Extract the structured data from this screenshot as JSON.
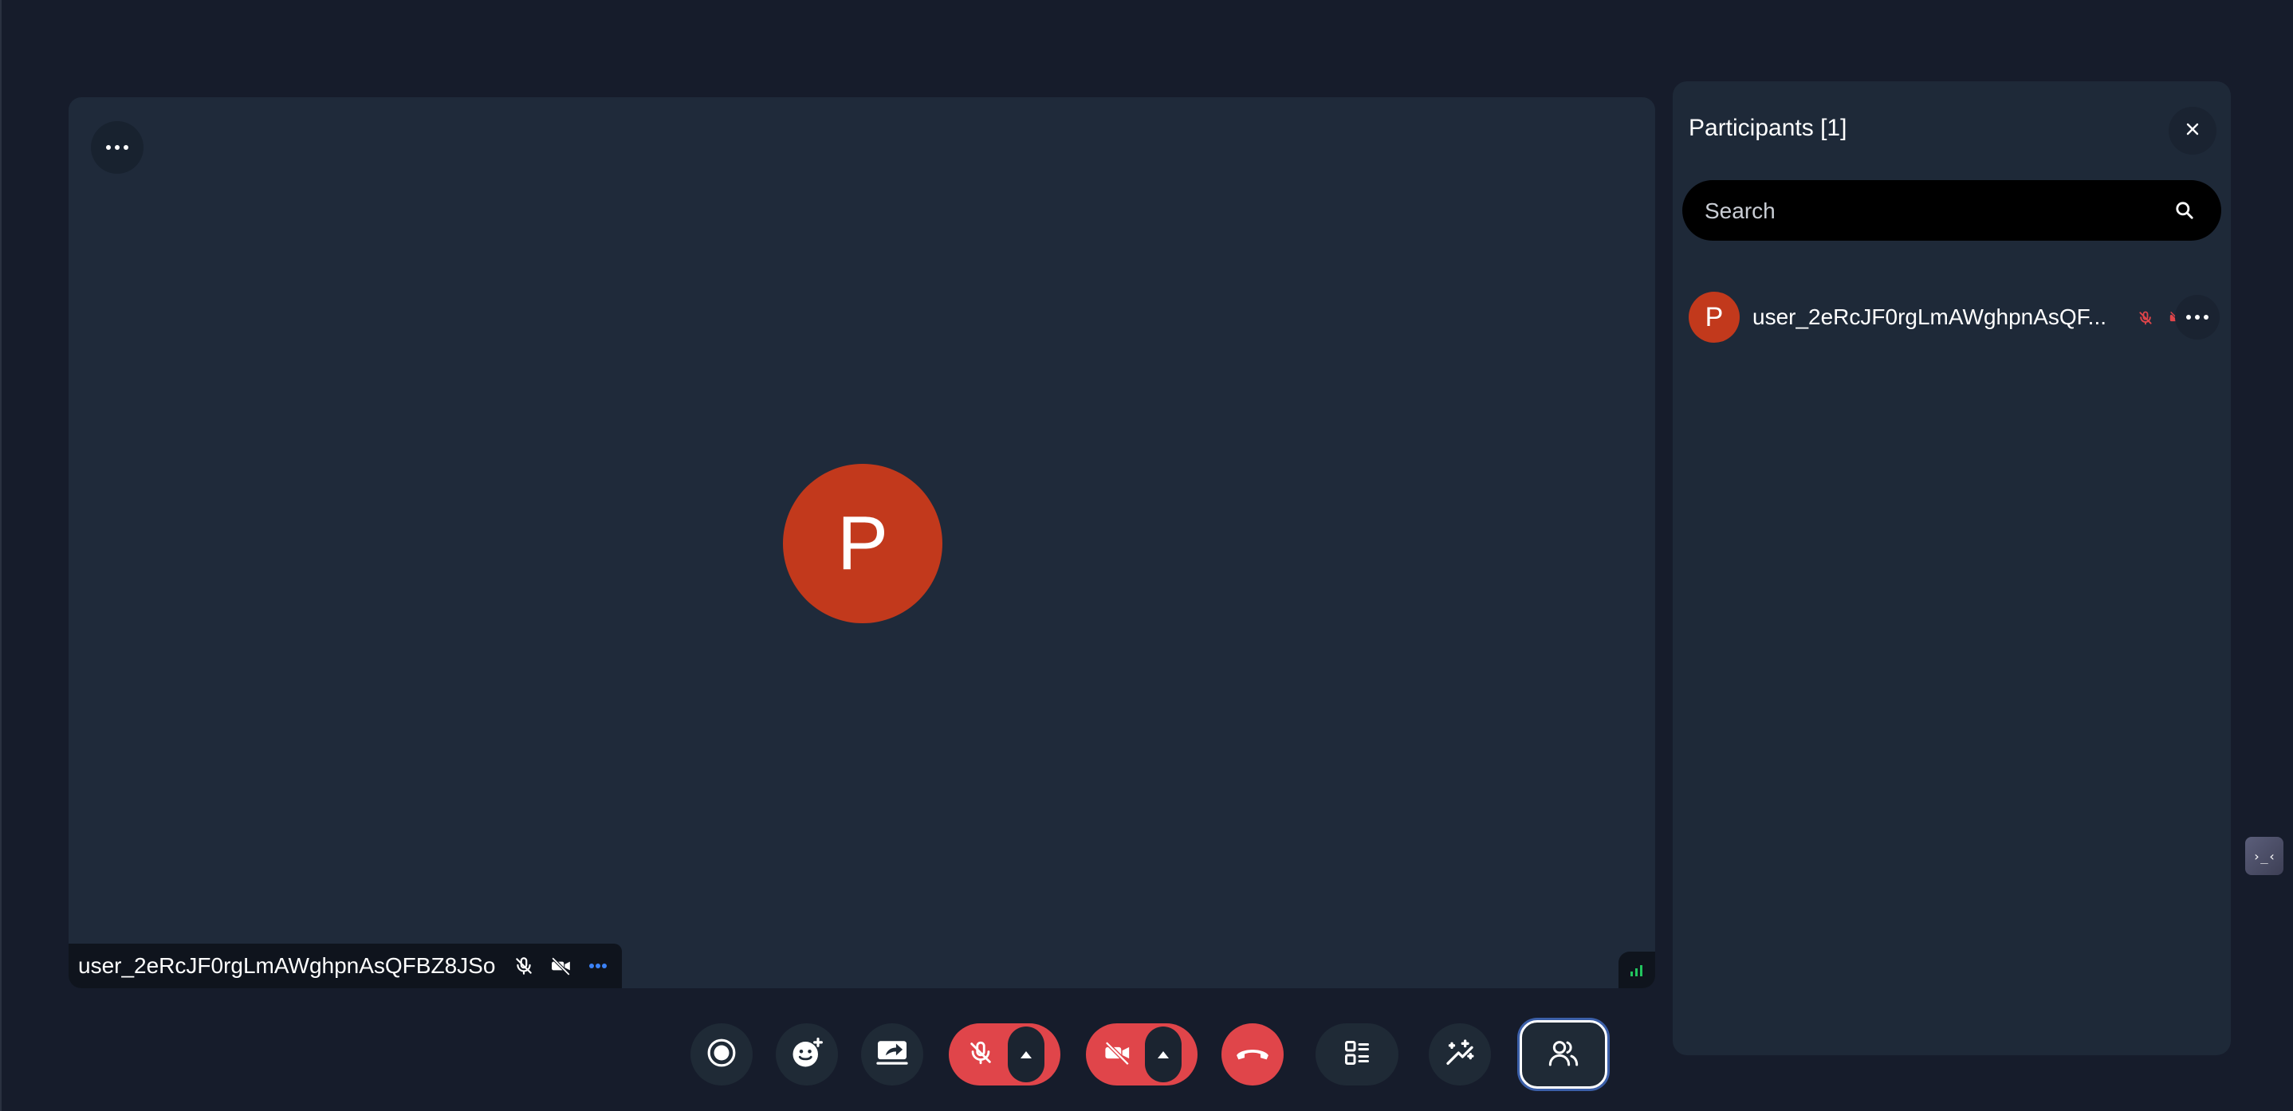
{
  "meeting": {
    "tile_avatar_letter": "P",
    "tile_display_name": "user_2eRcJF0rgLmAWghpnAsQFBZ8JSo",
    "mic_state": "muted",
    "camera_state": "off"
  },
  "toolbar": {
    "buttons": [
      {
        "name": "record",
        "icon": "record-icon"
      },
      {
        "name": "reactions",
        "icon": "emoji-add-icon"
      },
      {
        "name": "share-screen",
        "icon": "screen-share-icon"
      },
      {
        "name": "microphone",
        "icon": "mic-off-icon",
        "state": "muted"
      },
      {
        "name": "camera",
        "icon": "video-off-icon",
        "state": "off"
      },
      {
        "name": "leave-call",
        "icon": "hang-up-icon"
      },
      {
        "name": "layout",
        "icon": "layout-list-icon"
      },
      {
        "name": "effects",
        "icon": "sparkle-wand-icon"
      },
      {
        "name": "participants",
        "icon": "people-icon",
        "state": "active"
      }
    ]
  },
  "participants_panel": {
    "title": "Participants [1]",
    "search_placeholder": "Search",
    "participants": [
      {
        "avatar_letter": "P",
        "display_name": "user_2eRcJF0rgLmAWghpnAsQF...",
        "mic": "muted",
        "camera": "off"
      }
    ]
  },
  "side_widget": {
    "label": "›_‹"
  },
  "colors": {
    "background": "#161c2b",
    "stage": "#1f2a3a",
    "avatar": "#c2391c",
    "danger": "#e0454a",
    "panel": "#1e2938",
    "accent_blue": "#3b82f6"
  }
}
